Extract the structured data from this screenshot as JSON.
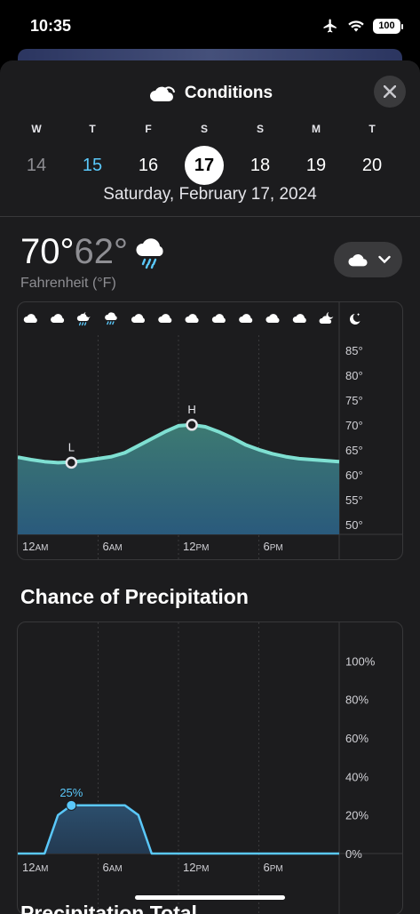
{
  "status": {
    "time": "10:35",
    "battery": "100"
  },
  "header": {
    "title": "Conditions",
    "icon": "cloud-icon",
    "close": "close-icon"
  },
  "days": [
    {
      "letter": "W",
      "num": "14",
      "state": "past"
    },
    {
      "letter": "T",
      "num": "15",
      "state": "today"
    },
    {
      "letter": "F",
      "num": "16",
      "state": ""
    },
    {
      "letter": "S",
      "num": "17",
      "state": "selected"
    },
    {
      "letter": "S",
      "num": "18",
      "state": ""
    },
    {
      "letter": "M",
      "num": "19",
      "state": ""
    },
    {
      "letter": "T",
      "num": "20",
      "state": ""
    }
  ],
  "selected_date": "Saturday, February 17, 2024",
  "summary": {
    "high": "70°",
    "low": "62°",
    "condition_icon": "rain-cloud-icon",
    "unit": "Fahrenheit (°F)"
  },
  "chart_data": [
    {
      "type": "area",
      "ylabel_ticks": [
        "85°",
        "80°",
        "75°",
        "70°",
        "65°",
        "60°",
        "55°",
        "50°"
      ],
      "yticks": [
        85,
        80,
        75,
        70,
        65,
        60,
        55,
        50
      ],
      "ylim": [
        48,
        88
      ],
      "xticks": [
        {
          "h": 0,
          "n": "12",
          "s": "AM"
        },
        {
          "h": 6,
          "n": "6",
          "s": "AM"
        },
        {
          "h": 12,
          "n": "12",
          "s": "PM"
        },
        {
          "h": 18,
          "n": "6",
          "s": "PM"
        }
      ],
      "x": [
        0,
        1,
        2,
        3,
        4,
        5,
        6,
        7,
        8,
        9,
        10,
        11,
        12,
        13,
        14,
        15,
        16,
        17,
        18,
        19,
        20,
        21,
        22,
        23,
        24
      ],
      "values": [
        63.5,
        63,
        62.6,
        62.4,
        62.5,
        62.8,
        63.2,
        63.6,
        64.4,
        65.8,
        67.2,
        68.6,
        69.8,
        70,
        69.6,
        68.6,
        67.4,
        66,
        65,
        64.2,
        63.6,
        63.2,
        63,
        62.8,
        62.6
      ],
      "markers": [
        {
          "label": "L",
          "x": 4,
          "y": 62.4
        },
        {
          "label": "H",
          "x": 13,
          "y": 70
        }
      ],
      "hour_icons": [
        "cloud-icon",
        "cloud-icon",
        "moon-cloud-rain-icon",
        "cloud-rain-icon",
        "cloud-icon",
        "cloud-icon",
        "cloud-icon",
        "cloud-icon",
        "cloud-icon",
        "cloud-icon",
        "cloud-icon",
        "moon-cloud-icon",
        "moon-icon"
      ]
    },
    {
      "type": "area",
      "title": "Chance of Precipitation",
      "ylabel_ticks": [
        "100%",
        "80%",
        "60%",
        "40%",
        "20%",
        "0%"
      ],
      "yticks": [
        100,
        80,
        60,
        40,
        20,
        0
      ],
      "ylim": [
        0,
        120
      ],
      "xticks": [
        {
          "h": 0,
          "n": "12",
          "s": "AM"
        },
        {
          "h": 6,
          "n": "6",
          "s": "AM"
        },
        {
          "h": 12,
          "n": "12",
          "s": "PM"
        },
        {
          "h": 18,
          "n": "6",
          "s": "PM"
        }
      ],
      "x": [
        0,
        1,
        2,
        3,
        4,
        5,
        6,
        7,
        8,
        9,
        10,
        11,
        12,
        13,
        14,
        15,
        16,
        17,
        18,
        19,
        20,
        21,
        22,
        23,
        24
      ],
      "values": [
        0,
        0,
        0,
        20,
        25,
        25,
        25,
        25,
        25,
        20,
        0,
        0,
        0,
        0,
        0,
        0,
        0,
        0,
        0,
        0,
        0,
        0,
        0,
        0,
        0
      ],
      "marker": {
        "label": "25%",
        "x": 4,
        "y": 25
      }
    }
  ],
  "next_section": "Precipitation Total",
  "colors": {
    "accent": "#5ac8fa",
    "sheet": "#1c1c1e",
    "line": "#7ee0d9"
  }
}
